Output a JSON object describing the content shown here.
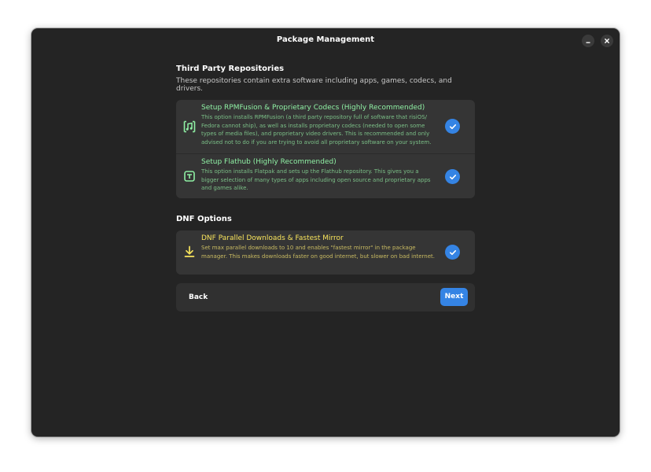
{
  "window": {
    "title": "Package Management"
  },
  "third_party": {
    "heading": "Third Party Repositories",
    "subtitle": "These repositories contain extra software including apps, games, codecs, and drivers.",
    "items": [
      {
        "title": "Setup RPMFusion & Proprietary Codecs (Highly Recommended)",
        "description": "This option installs RPMFusion (a third party repository full of software that risiOS/ Fedora cannot ship), as well as installs proprietary codecs (needed to open some types of media files), and proprietary video drivers. This is recommended and only advised not to do if you are trying to avoid all proprietary software on your system.",
        "icon": "music-file-icon",
        "checked": true
      },
      {
        "title": "Setup Flathub (Highly Recommended)",
        "description": "This option installs Flatpak and sets up the Flathub repository. This gives you a bigger selection of many types of apps including open source and proprietary apps and games alike.",
        "icon": "package-box-icon",
        "checked": true
      }
    ]
  },
  "dnf": {
    "heading": "DNF Options",
    "items": [
      {
        "title": "DNF Parallel Downloads & Fastest Mirror",
        "description": "Set max parallel downloads to 10 and enables \"fastest mirror\" in the package manager. This makes downloads faster on good internet, but slower on bad internet.",
        "icon": "download-icon",
        "checked": true
      }
    ]
  },
  "nav": {
    "back_label": "Back",
    "next_label": "Next"
  },
  "colors": {
    "accent": "#3584e4",
    "green": "#8ff0a4",
    "yellow": "#f8e45c",
    "window_bg": "#242424",
    "card_bg": "#353535"
  }
}
